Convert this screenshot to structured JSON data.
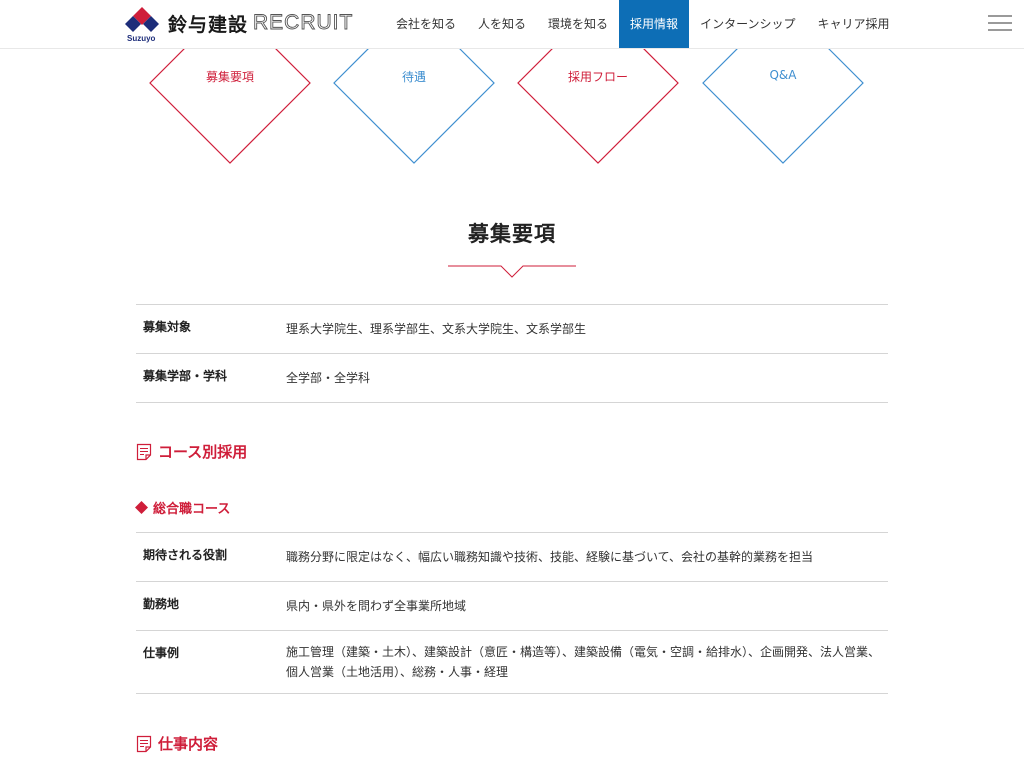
{
  "header": {
    "logo_sub": "Suzuyo",
    "logo_name": "鈴与建設",
    "logo_recruit": "RECRUIT",
    "nav": [
      "会社を知る",
      "人を知る",
      "環境を知る",
      "採用情報",
      "インターンシップ",
      "キャリア採用"
    ],
    "active_nav": "採用情報"
  },
  "diamonds": [
    {
      "label": "募集要項",
      "color": "#cf1e3a"
    },
    {
      "label": "待遇",
      "color": "#3f8fd0"
    },
    {
      "label": "採用フロー",
      "color": "#cf1e3a"
    },
    {
      "label": "Q&A",
      "color": "#3f8fd0"
    }
  ],
  "section_title": "募集要項",
  "recruit_table": [
    {
      "label": "募集対象",
      "value": "理系大学院生、理系学部生、文系大学院生、文系学部生"
    },
    {
      "label": "募集学部・学科",
      "value": "全学部・全学科"
    }
  ],
  "course_heading": "コース別採用",
  "course_subheading": "総合職コース",
  "course_table": [
    {
      "label": "期待される役割",
      "value": "職務分野に限定はなく、幅広い職務知識や技術、技能、経験に基づいて、会社の基幹的業務を担当"
    },
    {
      "label": "勤務地",
      "value": "県内・県外を問わず全事業所地域"
    },
    {
      "label": "仕事例",
      "value": "施工管理（建築・土木）、建築設計（意匠・構造等）、建築設備（電気・空調・給排水）、企画開発、法人営業、個人営業（土地活用）、総務・人事・経理"
    }
  ],
  "job_heading": "仕事内容",
  "colors": {
    "red": "#cf1e3a",
    "blue": "#3f8fd0",
    "nav_active": "#0d6eb6",
    "logo_navy": "#1d2d7a"
  },
  "icons": {
    "menu": "hamburger-icon",
    "diamond_arrow": "chevron-down-icon",
    "heading": "document-icon",
    "bullet": "diamond-bullet-icon"
  }
}
